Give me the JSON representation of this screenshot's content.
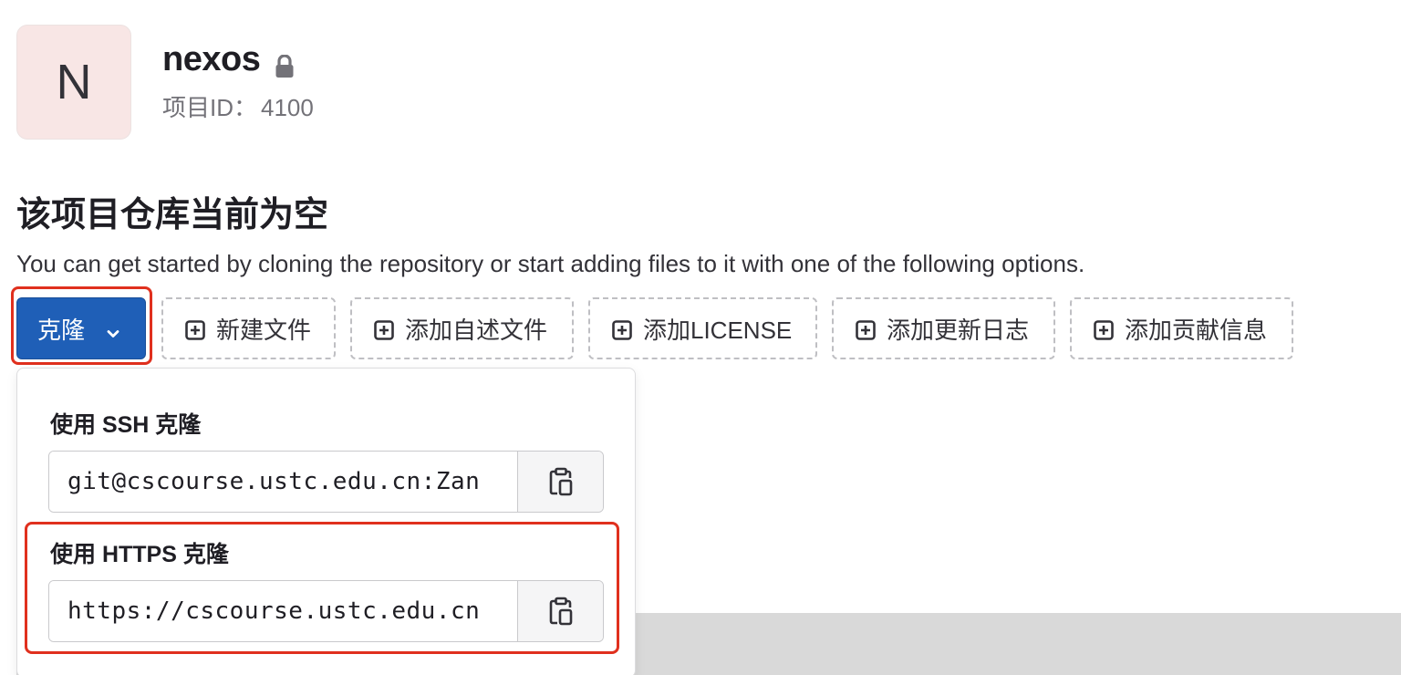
{
  "project": {
    "avatar_letter": "N",
    "name": "nexos",
    "lock_icon": "lock-icon",
    "id_label": "项目ID：",
    "id_value": "4100"
  },
  "empty_repo": {
    "title": "该项目仓库当前为空",
    "description": "You can get started by cloning the repository or start adding files to it with one of the following options."
  },
  "actions": {
    "clone_label": "克隆",
    "buttons": [
      {
        "label": "新建文件",
        "icon": "plus-square-icon"
      },
      {
        "label": "添加自述文件",
        "icon": "plus-square-icon"
      },
      {
        "label": "添加LICENSE",
        "icon": "plus-square-icon"
      },
      {
        "label": "添加更新日志",
        "icon": "plus-square-icon"
      },
      {
        "label": "添加贡献信息",
        "icon": "plus-square-icon"
      }
    ]
  },
  "clone_dropdown": {
    "ssh_label": "使用 SSH 克隆",
    "ssh_url": "git@cscourse.ustc.edu.cn:Zan",
    "https_label": "使用 HTTPS 克隆",
    "https_url": "https://cscourse.ustc.edu.cn",
    "copy_icon": "clipboard-icon"
  },
  "colors": {
    "primary": "#1f5fb7",
    "highlight": "#e0301e",
    "avatar_bg": "#f8e6e5"
  }
}
